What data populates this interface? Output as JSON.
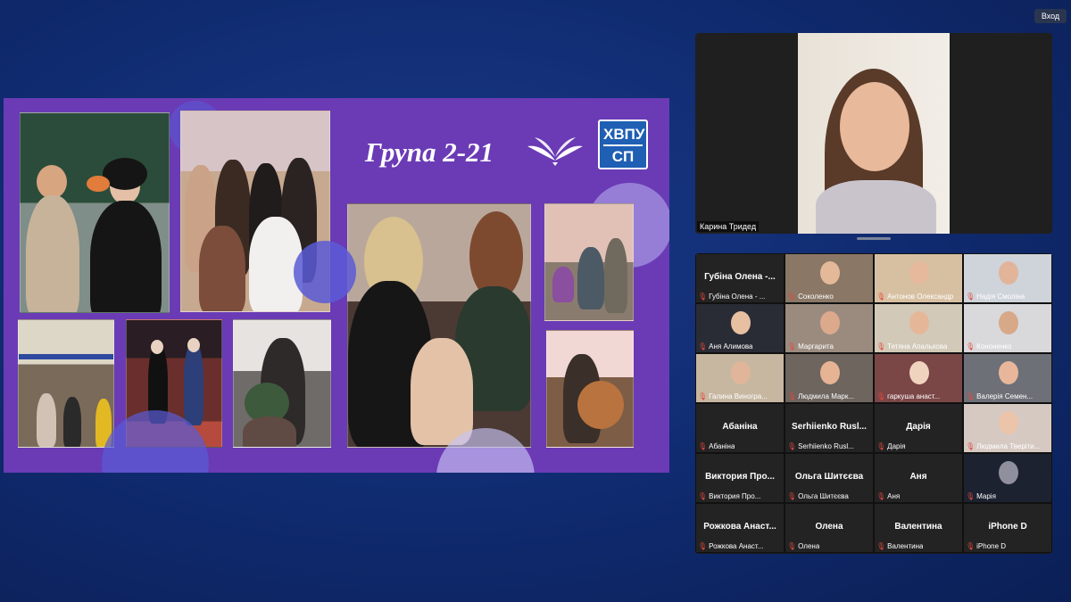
{
  "app": {
    "enter_label": "Вход"
  },
  "slide": {
    "title": "Група 2-21",
    "logo_line1": "ХВПУ",
    "logo_line2": "СП",
    "colors": {
      "background": "#6a3bb5",
      "circle_blue": "#5a5bd6",
      "circle_light": "#c7c3f5"
    }
  },
  "speaker": {
    "name": "Карина Тридед"
  },
  "gallery": {
    "tiles": [
      {
        "big": "Губіна Олена -...",
        "label": "Губіна Олена - ...",
        "video": false
      },
      {
        "big": "",
        "label": "Соколенко",
        "video": true,
        "bg": "#8a7766",
        "face": "#e3b99a"
      },
      {
        "big": "",
        "label": "Антонов Олександр",
        "video": true,
        "bg": "#d7c0a2",
        "face": "#e6b99c"
      },
      {
        "big": "",
        "label": "Надія Смоліна",
        "video": true,
        "bg": "#cfd3da",
        "face": "#e2b49a"
      },
      {
        "big": "",
        "label": "Аня Алимова",
        "video": true,
        "bg": "#2a2c35",
        "face": "#e7c0a2"
      },
      {
        "big": "",
        "label": "Маргарита",
        "video": true,
        "bg": "#9b8b7f",
        "face": "#dca98d"
      },
      {
        "big": "",
        "label": "Тетяна Апалькова",
        "video": true,
        "bg": "#d2c9b8",
        "face": "#e5b798"
      },
      {
        "big": "",
        "label": "Кононенко",
        "video": true,
        "bg": "#d9d9dc",
        "face": "#d7a988"
      },
      {
        "big": "",
        "label": "Галина Виногра...",
        "video": true,
        "bg": "#c7b7a1",
        "face": "#e1b59a"
      },
      {
        "big": "",
        "label": "Людмила Марк...",
        "video": true,
        "bg": "#6d655e",
        "face": "#e6b394"
      },
      {
        "big": "",
        "label": "гаркуша анаст...",
        "video": true,
        "bg": "#7b4646",
        "face": "#f0d3bf"
      },
      {
        "big": "",
        "label": "Валерія Семен...",
        "video": true,
        "bg": "#6e7077",
        "face": "#e8b79b"
      },
      {
        "big": "Абаніна",
        "label": "Абаніна",
        "video": false
      },
      {
        "big": "Serhiienko Rusl...",
        "label": "Serhiienko Rusl...",
        "video": false
      },
      {
        "big": "Дарія",
        "label": "Дарія",
        "video": false
      },
      {
        "big": "",
        "label": "Людмила Тверіти...",
        "video": true,
        "bg": "#d5c9c2",
        "face": "#ebc4aa"
      },
      {
        "big": "Виктория Про...",
        "label": "Виктория Про...",
        "video": false
      },
      {
        "big": "Ольга Шитєєва",
        "label": "Ольга Шитєєва",
        "video": false
      },
      {
        "big": "Аня",
        "label": "Аня",
        "video": false
      },
      {
        "big": "",
        "label": "Марія",
        "video": true,
        "bg": "#1c2230",
        "face": "#8f8f9e"
      },
      {
        "big": "Рожкова Анаст...",
        "label": "Рожкова Анаст...",
        "video": false
      },
      {
        "big": "Олена",
        "label": "Олена",
        "video": false
      },
      {
        "big": "Валентина",
        "label": "Валентина",
        "video": false
      },
      {
        "big": "iPhone D",
        "label": "iPhone D",
        "video": false
      }
    ]
  }
}
